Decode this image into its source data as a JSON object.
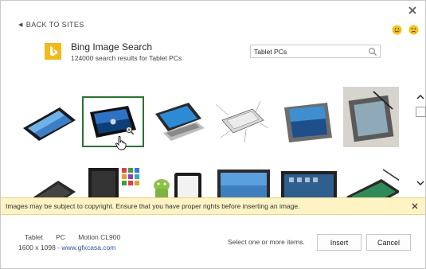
{
  "nav": {
    "back_label": "BACK TO SITES"
  },
  "header": {
    "title": "Bing Image Search",
    "subtitle": "124000 search results for Tablet PCs"
  },
  "search": {
    "value": "Tablet PCs"
  },
  "feedback": {
    "smile_icon": "smile-icon",
    "frown_icon": "frown-icon"
  },
  "results": {
    "row1": [
      {
        "icon": "tablet-landscape-image"
      },
      {
        "icon": "tablet-windows-image",
        "selected": true
      },
      {
        "icon": "tablet-keyboard-image"
      },
      {
        "icon": "tablet-diagram-image"
      },
      {
        "icon": "tablet-rugged-image"
      },
      {
        "icon": "tablet-stylus-image"
      }
    ],
    "row2": [
      {
        "icon": "tablet-dark-image"
      },
      {
        "icon": "tablet-apps-image"
      },
      {
        "icon": "android-ipad-image"
      },
      {
        "icon": "tablet-asus-image"
      },
      {
        "icon": "tablet-samsung-image"
      },
      {
        "icon": "tablet-stylus-green-image"
      }
    ]
  },
  "banner": {
    "text": "Images may be subject to copyright. Ensure that you have proper rights before inserting an image."
  },
  "details": {
    "tag1": "Tablet",
    "tag2": "PC",
    "tag3": "Motion CL900",
    "dimensions": "1600 x 1098",
    "separator": " - ",
    "source": "www.gfxcasa.com"
  },
  "footer": {
    "hint": "Select one or more items.",
    "insert_label": "Insert",
    "cancel_label": "Cancel"
  },
  "colors": {
    "bing_logo": "#f2b91a",
    "selection_border": "#2a7230",
    "banner_bg": "#fdf3c4",
    "link": "#2b5797",
    "smile": "#f5c518"
  }
}
